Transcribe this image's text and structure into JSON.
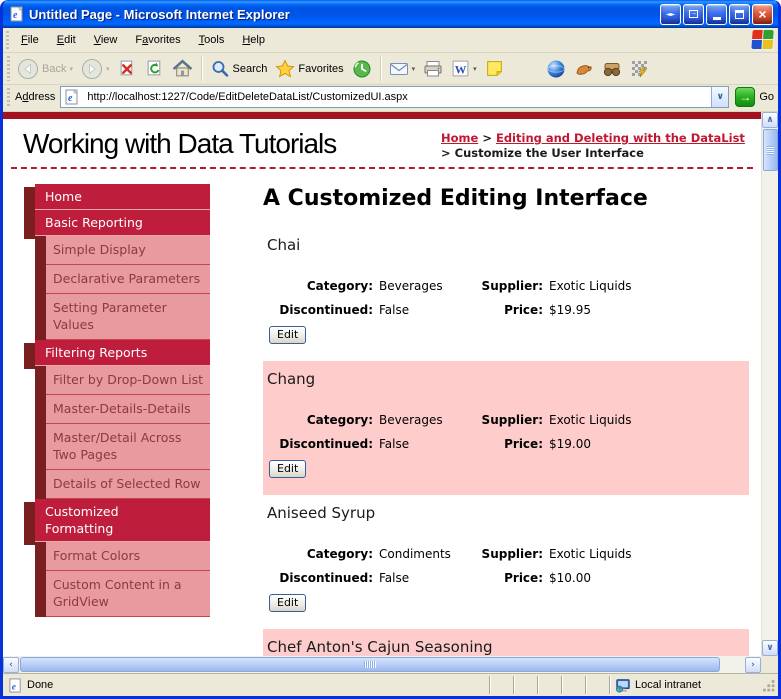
{
  "window": {
    "title": "Untitled Page - Microsoft Internet Explorer"
  },
  "menu": {
    "items": [
      {
        "label": "File",
        "u": 0
      },
      {
        "label": "Edit",
        "u": 0
      },
      {
        "label": "View",
        "u": 0
      },
      {
        "label": "Favorites",
        "u": 1
      },
      {
        "label": "Tools",
        "u": 0
      },
      {
        "label": "Help",
        "u": 0
      }
    ]
  },
  "toolbar": {
    "back_label": "Back",
    "search_label": "Search",
    "favorites_label": "Favorites"
  },
  "addressbar": {
    "label": "Address",
    "u": 1,
    "url": "http://localhost:1227/Code/EditDeleteDataList/CustomizedUI.aspx",
    "go_label": "Go"
  },
  "header": {
    "site_title": "Working with Data Tutorials",
    "separator": ">",
    "breadcrumb": [
      {
        "label": "Home",
        "type": "link"
      },
      {
        "label": "Editing and Deleting with the DataList",
        "type": "link"
      },
      {
        "label": "Customize the User Interface",
        "type": "current"
      }
    ]
  },
  "sidebar": {
    "items": [
      {
        "label": "Home",
        "level": "top"
      },
      {
        "label": "Basic Reporting",
        "level": "top"
      },
      {
        "label": "Simple Display",
        "level": "sub"
      },
      {
        "label": "Declarative Parameters",
        "level": "sub"
      },
      {
        "label": "Setting Parameter Values",
        "level": "sub"
      },
      {
        "label": "Filtering Reports",
        "level": "top"
      },
      {
        "label": "Filter by Drop-Down List",
        "level": "sub"
      },
      {
        "label": "Master-Details-Details",
        "level": "sub"
      },
      {
        "label": "Master/Detail Across Two Pages",
        "level": "sub"
      },
      {
        "label": "Details of Selected Row",
        "level": "sub"
      },
      {
        "label": "Customized Formatting",
        "level": "top"
      },
      {
        "label": "Format Colors",
        "level": "sub"
      },
      {
        "label": "Custom Content in a GridView",
        "level": "sub"
      }
    ]
  },
  "content": {
    "heading": "A Customized Editing Interface",
    "field_labels": {
      "category": "Category:",
      "supplier": "Supplier:",
      "discontinued": "Discontinued:",
      "price": "Price:"
    },
    "edit_button": "Edit",
    "products": [
      {
        "name": "Chai",
        "category": "Beverages",
        "supplier": "Exotic Liquids",
        "discontinued": "False",
        "price": "$19.95",
        "highlighted": false,
        "clipped": false
      },
      {
        "name": "Chang",
        "category": "Beverages",
        "supplier": "Exotic Liquids",
        "discontinued": "False",
        "price": "$19.00",
        "highlighted": true,
        "clipped": false
      },
      {
        "name": "Aniseed Syrup",
        "category": "Condiments",
        "supplier": "Exotic Liquids",
        "discontinued": "False",
        "price": "$10.00",
        "highlighted": false,
        "clipped": false
      },
      {
        "name": "Chef Anton's Cajun Seasoning",
        "category": "",
        "supplier": "",
        "discontinued": "",
        "price": "",
        "highlighted": true,
        "clipped": true
      }
    ]
  },
  "statusbar": {
    "status": "Done",
    "zone": "Local intranet"
  },
  "icons": {
    "pan": "◄►",
    "popout_arrow": "→",
    "close": "×",
    "caret": "▾",
    "dropdown": "∨",
    "go_arrow": "→",
    "scroll_up": "∧",
    "scroll_down": "∨",
    "scroll_left": "‹",
    "scroll_right": "›"
  },
  "colors": {
    "theme_red": "#a3121f",
    "menu_red": "#be1e3c",
    "menu_maroon": "#7a1f1f",
    "menu_pink": "#e89a9e",
    "highlight_pink": "#ffcccc",
    "link_red": "#c01830",
    "chrome": "#ece9d8",
    "titlebar_blue": "#0054e3"
  }
}
